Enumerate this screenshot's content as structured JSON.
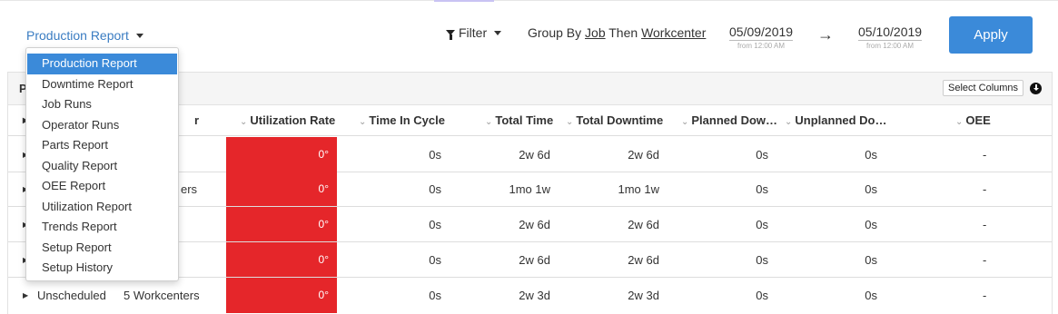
{
  "toolbar": {
    "report_label": "Production Report",
    "filter_label": "Filter",
    "group_by_prefix": "Group By",
    "group_by_first": "Job",
    "group_by_middle": "Then",
    "group_by_second": "Workcenter",
    "date_from": "05/09/2019",
    "date_from_time": "from 12:00 AM",
    "date_arrow": "→",
    "date_to": "05/10/2019",
    "date_to_time": "from 12:00 AM",
    "apply_label": "Apply"
  },
  "panel": {
    "title_partial": "P",
    "select_columns_label": "Select Columns"
  },
  "table": {
    "header_partial": "r",
    "columns": {
      "utilization_rate": "Utilization Rate",
      "time_in_cycle": "Time In Cycle",
      "total_time": "Total Time",
      "total_downtime": "Total Downtime",
      "planned_downtime": "Planned Dow…",
      "unplanned_downtime": "Unplanned Do…",
      "oee": "OEE"
    },
    "rows": [
      {
        "job": "",
        "workcenter": "",
        "utilization": "0°",
        "time_in_cycle": "0s",
        "total_time": "2w 6d",
        "total_downtime": "2w 6d",
        "planned": "0s",
        "unplanned": "0s",
        "oee": "-"
      },
      {
        "job": "",
        "workcenter": "ers",
        "utilization": "0°",
        "time_in_cycle": "0s",
        "total_time": "1mo 1w",
        "total_downtime": "1mo 1w",
        "planned": "0s",
        "unplanned": "0s",
        "oee": "-"
      },
      {
        "job": "",
        "workcenter": "",
        "utilization": "0°",
        "time_in_cycle": "0s",
        "total_time": "2w 6d",
        "total_downtime": "2w 6d",
        "planned": "0s",
        "unplanned": "0s",
        "oee": "-"
      },
      {
        "job": "",
        "workcenter": "",
        "utilization": "0°",
        "time_in_cycle": "0s",
        "total_time": "2w 6d",
        "total_downtime": "2w 6d",
        "planned": "0s",
        "unplanned": "0s",
        "oee": "-"
      },
      {
        "job": "Unscheduled",
        "workcenter": "5 Workcenters",
        "utilization": "0°",
        "time_in_cycle": "0s",
        "total_time": "2w 3d",
        "total_downtime": "2w 3d",
        "planned": "0s",
        "unplanned": "0s",
        "oee": "-"
      }
    ]
  },
  "report_menu": {
    "items": [
      "Production Report",
      "Downtime Report",
      "Job Runs",
      "Operator Runs",
      "Parts Report",
      "Quality Report",
      "OEE Report",
      "Utilization Report",
      "Trends Report",
      "Setup Report",
      "Setup History"
    ],
    "selected": "Production Report"
  },
  "colors": {
    "accent": "#3b8ad9",
    "link": "#3a7cc2",
    "utilization_bad": "#e5262a"
  }
}
